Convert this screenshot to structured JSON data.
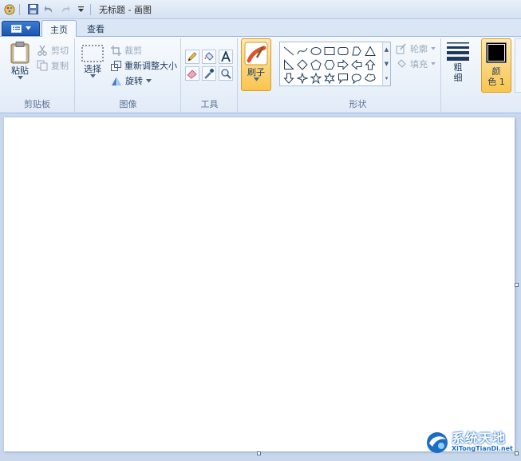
{
  "window": {
    "title": "无标题 - 画图"
  },
  "tabs": {
    "home": "主页",
    "view": "查看"
  },
  "clipboard": {
    "group_label": "剪贴板",
    "paste": "粘贴",
    "cut": "剪切",
    "copy": "复制"
  },
  "image": {
    "group_label": "图像",
    "select": "选择",
    "crop": "裁剪",
    "resize": "重新调整大小",
    "rotate": "旋转"
  },
  "tools": {
    "group_label": "工具"
  },
  "brush": {
    "label": "刷子"
  },
  "shapes": {
    "group_label": "形状",
    "outline": "轮廓",
    "fill": "填充"
  },
  "size": {
    "label_1": "粗",
    "label_2": "细"
  },
  "color1": {
    "label_1": "颜",
    "label_2": "色 1",
    "value": "#000000"
  },
  "watermark": {
    "cn": "系统天地",
    "en": "XiTongTianDi.net"
  },
  "colors": {
    "ribbon_accent": "#f9c54e",
    "menu_blue": "#1c56b0",
    "canvas_bg": "#c8d7ec"
  }
}
